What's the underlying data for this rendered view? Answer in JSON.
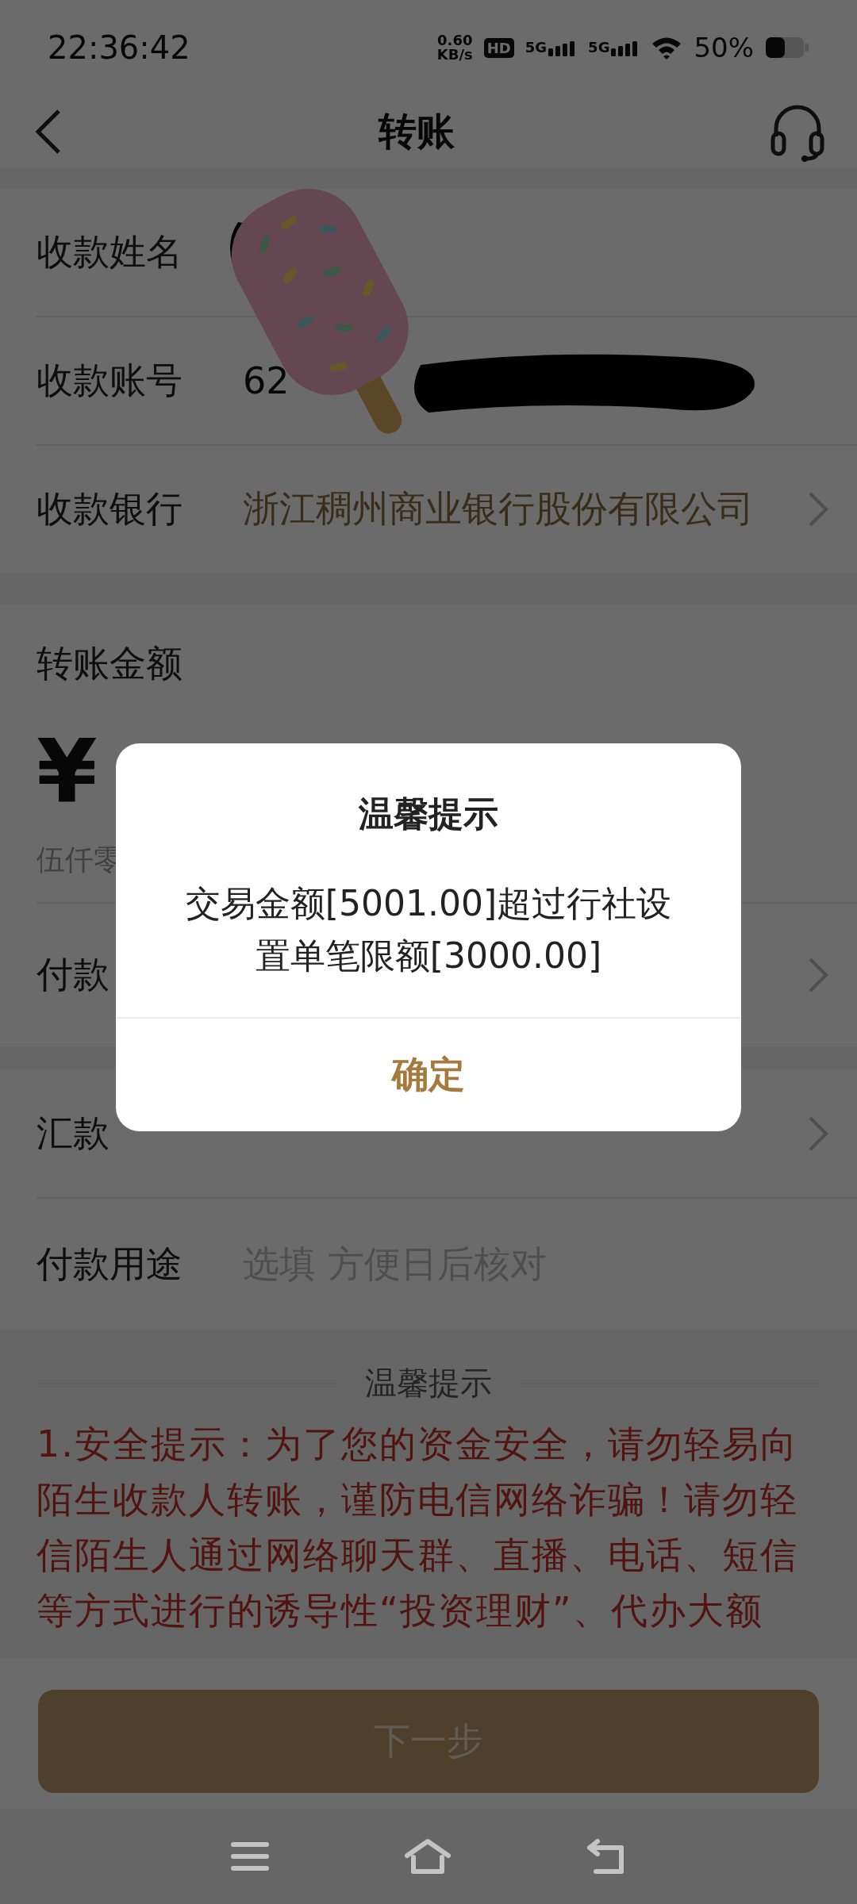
{
  "status_bar": {
    "time": "22:36:42",
    "speed": "0.60",
    "speed_unit": "KB/s",
    "hd": "HD",
    "sims": [
      {
        "label": "5G"
      },
      {
        "label": "5G"
      }
    ],
    "battery": "50%"
  },
  "header": {
    "title": "转账"
  },
  "payee": [
    {
      "label": "收款姓名",
      "kind": "redacted"
    },
    {
      "label": "收款账号",
      "value": "62",
      "kind": "redacted"
    },
    {
      "label": "收款银行",
      "value": "浙江稠州商业银行股份有限公司",
      "kind": "link"
    }
  ],
  "amount": {
    "label": "转账金额",
    "currency": "¥",
    "words": "伍仟零"
  },
  "payer": {
    "label": "付款"
  },
  "method": {
    "label": "汇款"
  },
  "purpose": {
    "label": "付款用途",
    "placeholder": "选填 方便日后核对"
  },
  "tips": {
    "title": "温馨提示",
    "text": "1.安全提示：为了您的资金安全，请勿轻易向陌生收款人转账，谨防电信网络诈骗！请勿轻信陌生人通过网络聊天群、直播、电话、短信等方式进行的诱导性“投资理财”、代办大额"
  },
  "next_button": {
    "label": "下一步",
    "disabled": true
  },
  "dialog": {
    "title": "温馨提示",
    "message": "交易金额[5001.00]超过行社设置单笔限额[3000.00]",
    "button": "确定"
  }
}
